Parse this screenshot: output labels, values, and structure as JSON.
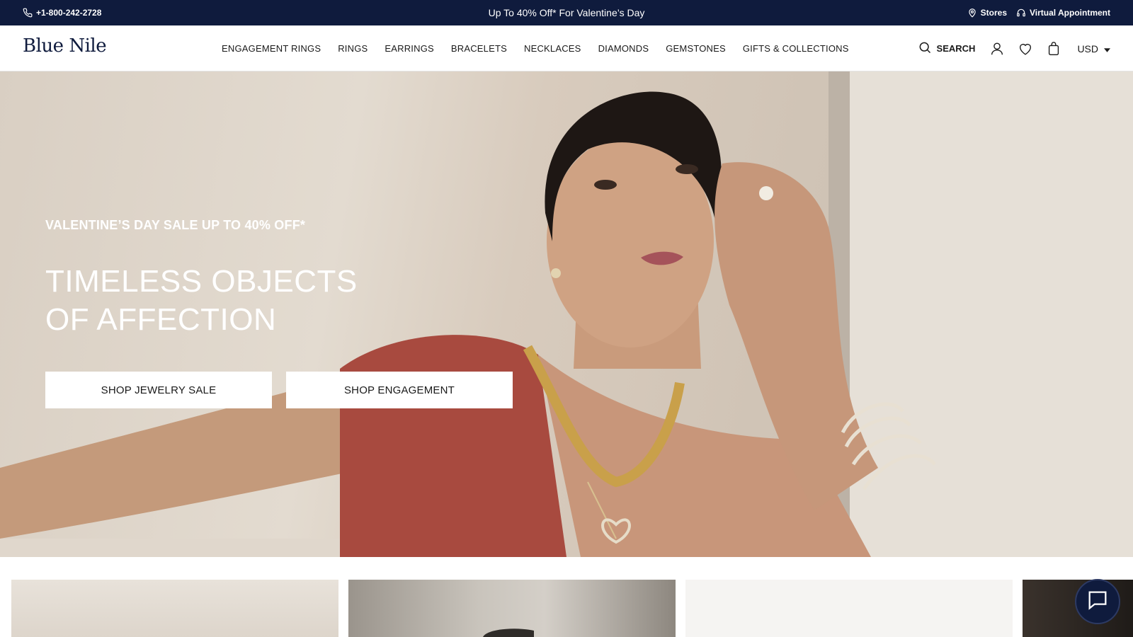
{
  "topbar": {
    "phone": "+1-800-242-2728",
    "promo": "Up To 40% Off* For Valentine’s Day",
    "stores": "Stores",
    "virtual": "Virtual Appointment"
  },
  "header": {
    "logo": "Blue Nile",
    "nav": [
      "ENGAGEMENT RINGS",
      "RINGS",
      "EARRINGS",
      "BRACELETS",
      "NECKLACES",
      "DIAMONDS",
      "GEMSTONES",
      "GIFTS & COLLECTIONS"
    ],
    "search_label": "SEARCH",
    "currency": "USD"
  },
  "hero": {
    "eyebrow": "VALENTINE’S DAY SALE UP TO 40% OFF*",
    "headline_line1": "TIMELESS OBJECTS",
    "headline_line2": "OF AFFECTION",
    "cta_primary": "SHOP JEWELRY SALE",
    "cta_secondary": "SHOP ENGAGEMENT"
  },
  "colors": {
    "brand_navy": "#0f1b3d",
    "hero_bg": "#d9cfc3",
    "dress_red": "#a84a3f"
  },
  "icons": [
    "phone-icon",
    "location-pin-icon",
    "headset-icon",
    "search-icon",
    "account-icon",
    "heart-icon",
    "bag-icon",
    "caret-down-icon",
    "chat-icon"
  ]
}
